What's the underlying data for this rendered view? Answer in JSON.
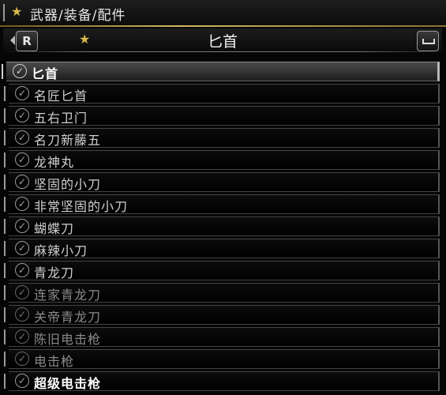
{
  "breadcrumb": {
    "text": "武器/装备/配件"
  },
  "header": {
    "left_button": "R",
    "title": "匕首",
    "right_button_icon": "space-key-icon"
  },
  "list": {
    "items": [
      {
        "label": "匕首",
        "state": "selected"
      },
      {
        "label": "名匠匕首",
        "state": "normal"
      },
      {
        "label": "五右卫门",
        "state": "normal"
      },
      {
        "label": "名刀新藤五",
        "state": "normal"
      },
      {
        "label": "龙神丸",
        "state": "normal"
      },
      {
        "label": "坚固的小刀",
        "state": "normal"
      },
      {
        "label": "非常坚固的小刀",
        "state": "normal"
      },
      {
        "label": "蝴蝶刀",
        "state": "normal"
      },
      {
        "label": "麻辣小刀",
        "state": "normal"
      },
      {
        "label": "青龙刀",
        "state": "normal"
      },
      {
        "label": "连家青龙刀",
        "state": "dim"
      },
      {
        "label": "关帝青龙刀",
        "state": "dim"
      },
      {
        "label": "陈旧电击枪",
        "state": "dim"
      },
      {
        "label": "电击枪",
        "state": "dim"
      },
      {
        "label": "超级电击枪",
        "state": "bright"
      }
    ]
  },
  "colors": {
    "accent_gold": "#d9b94a",
    "selected_row": "#4a4a4a"
  }
}
